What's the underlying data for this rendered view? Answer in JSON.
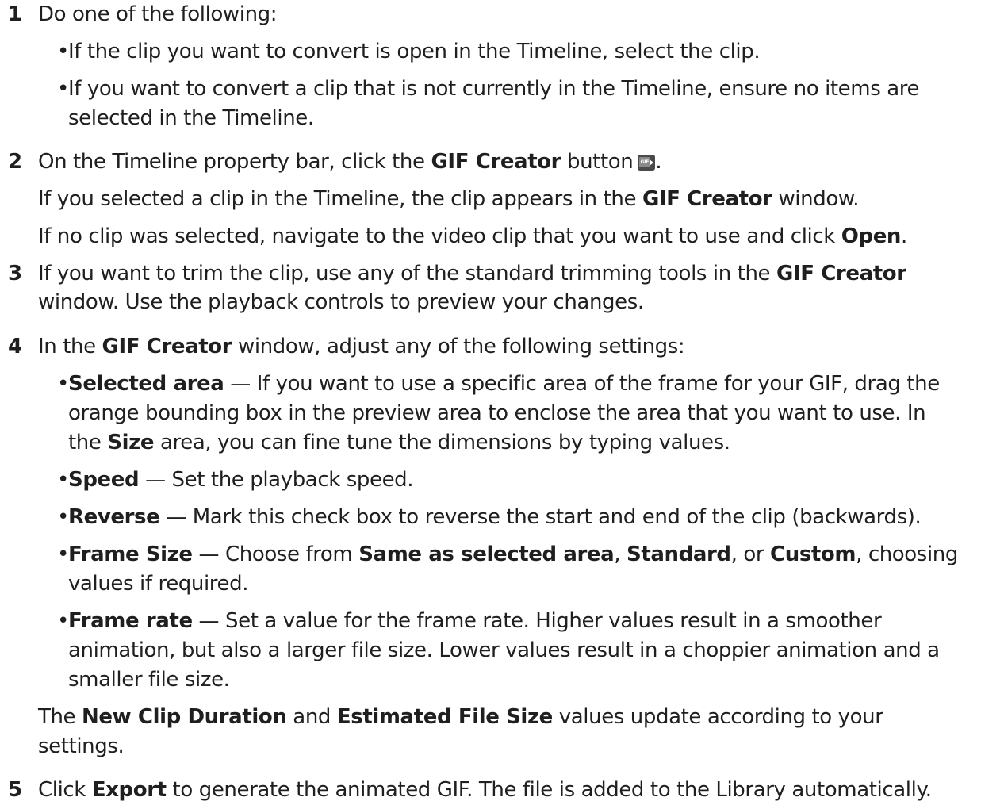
{
  "steps": {
    "s1": {
      "num": "1",
      "text": "Do one of the following:",
      "b1": "If the clip you want to convert is open in the Timeline, select the clip.",
      "b2_l1": "If you want to convert a clip that is not currently in the Timeline, ensure no items are",
      "b2_l2": "selected in the Timeline."
    },
    "s2": {
      "num": "2",
      "l1a": "On the Timeline property bar, click the ",
      "l1b": "GIF Creator",
      "l1c": " button",
      "l1d": ".",
      "icon_text": "GIF",
      "l2a": "If you selected a clip in the Timeline, the clip appears in the ",
      "l2b": "GIF Creator",
      "l2c": " window.",
      "l3a": "If no clip was selected, navigate to the video clip that you want to use and click ",
      "l3b": "Open",
      "l3c": "."
    },
    "s3": {
      "num": "3",
      "l1a": "If you want to trim the clip, use any of the standard trimming tools in the ",
      "l1b": "GIF Creator",
      "l2": "window. Use the playback controls to preview your changes."
    },
    "s4": {
      "num": "4",
      "l1a": "In the ",
      "l1b": "GIF Creator",
      "l1c": " window, adjust any of the following settings:",
      "sel_term": "Selected area",
      "sel_l1": " — If you want to use a specific area of the frame for your GIF, drag the",
      "sel_l2": "orange bounding box in the preview area to enclose the area that you want to use. In",
      "sel_l3a": "the ",
      "sel_l3b": "Size",
      "sel_l3c": " area, you can fine tune the dimensions by typing values.",
      "speed_term": "Speed",
      "speed_text": " — Set the playback speed.",
      "rev_term": "Reverse",
      "rev_text": " — Mark this check box to reverse the start and end of the clip (backwards).",
      "fs_term": "Frame Size",
      "fs_a": " — Choose from ",
      "fs_b": "Same as selected area",
      "fs_c": ", ",
      "fs_d": "Standard",
      "fs_e": ", or ",
      "fs_f": "Custom",
      "fs_g": ", choosing",
      "fs_l2": "values if required.",
      "fr_term": "Frame rate",
      "fr_l1": " — Set a value for the frame rate. Higher values result in a smoother",
      "fr_l2": "animation, but also a larger file size. Lower values result in a choppier animation and a",
      "fr_l3": "smaller file size.",
      "ncd_a": "The ",
      "ncd_b": "New Clip Duration",
      "ncd_c": " and ",
      "ncd_d": "Estimated File Size",
      "ncd_e": " values update according to your",
      "ncd_l2": "settings."
    },
    "s5": {
      "num": "5",
      "a": "Click ",
      "b": "Export",
      "c": " to generate the animated GIF. The file is added to the Library automatically."
    }
  }
}
